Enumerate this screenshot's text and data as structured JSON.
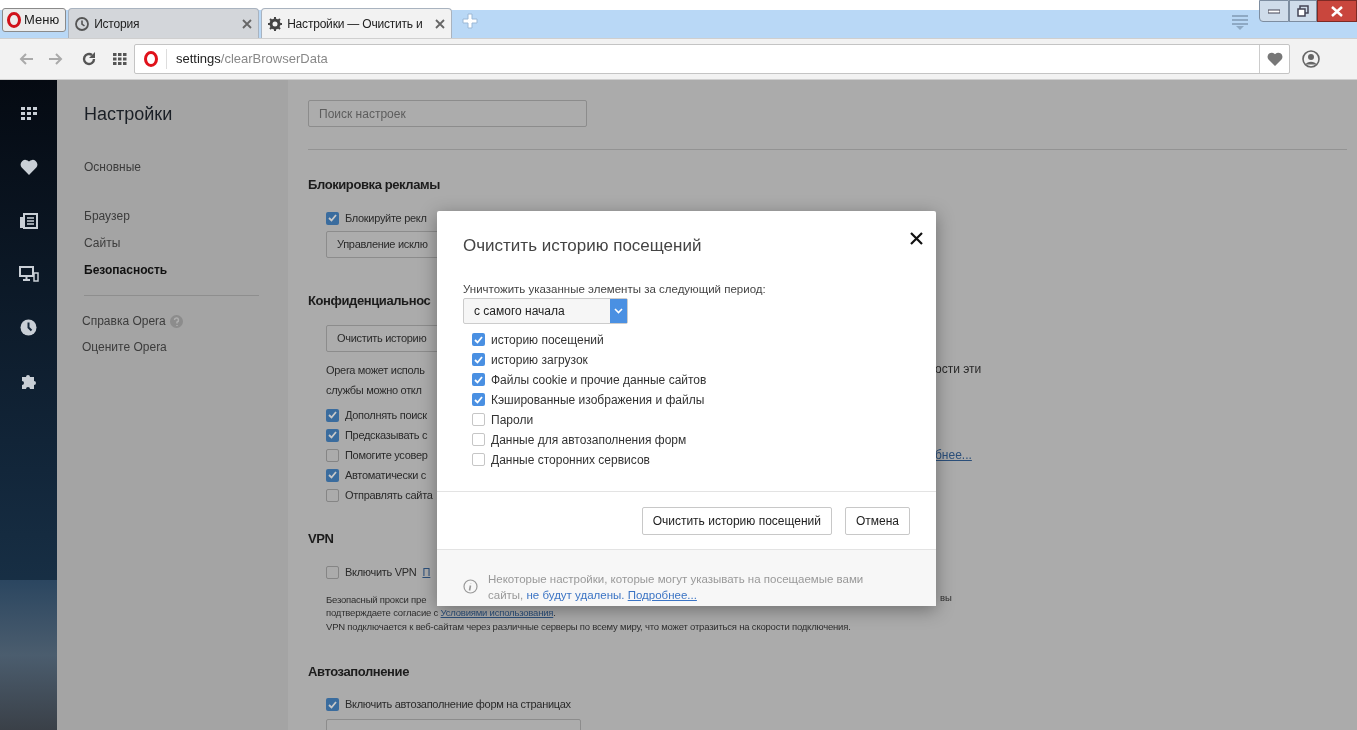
{
  "browser": {
    "menu_label": "Меню",
    "tabs": [
      {
        "title": "История",
        "selected": false
      },
      {
        "title": "Настройки — Очистить и",
        "selected": true
      }
    ],
    "address": {
      "host": "settings",
      "path": "/clearBrowserData"
    }
  },
  "sidebar": {
    "title": "Настройки",
    "groups": [
      [
        {
          "label": "Основные",
          "selected": false
        }
      ],
      [
        {
          "label": "Браузер",
          "selected": false
        },
        {
          "label": "Сайты",
          "selected": false
        },
        {
          "label": "Безопасность",
          "selected": true
        }
      ]
    ],
    "links": [
      {
        "label": "Справка Opera",
        "help": true
      },
      {
        "label": "Оцените Opera",
        "help": false
      }
    ]
  },
  "search": {
    "placeholder": "Поиск настроек"
  },
  "sections": [
    {
      "heading": "Блокировка рекламы",
      "items": [
        {
          "kind": "checkbox",
          "label": "Блокируйте рекл",
          "checked": true
        },
        {
          "kind": "button",
          "label": "Управление исклю"
        }
      ]
    },
    {
      "heading": "Конфиденциальнос",
      "items": [
        {
          "kind": "button",
          "label": "Очистить историю"
        },
        {
          "kind": "paragraph",
          "lines": [
            {
              "left": "Opera может исполь",
              "right": "ости эти"
            },
            {
              "left": "службы можно откл"
            }
          ]
        },
        {
          "kind": "checkbox",
          "label": "Дополнять поиск",
          "checked": true
        },
        {
          "kind": "checkbox",
          "label": "Предсказывать с",
          "checked": true
        },
        {
          "kind": "checkbox",
          "label": "Помогите усовер",
          "checked": false,
          "right_link": "бнее..."
        },
        {
          "kind": "checkbox",
          "label": "Автоматически с",
          "checked": true
        },
        {
          "kind": "checkbox",
          "label": "Отправлять сайта",
          "checked": false
        }
      ]
    },
    {
      "heading": "VPN",
      "items": [
        {
          "kind": "checkbox",
          "label": "Включить VPN",
          "checked": false,
          "link": "П"
        },
        {
          "kind": "note",
          "lines": [
            {
              "text": "Безопасный прокси пре",
              "right": "вы"
            },
            {
              "text": "подтверждаете согласие с",
              "link": "Условиями использования",
              "after": "."
            },
            {
              "text": "VPN подключается к веб-сайтам через различные серверы по всему миру, что может отразиться на скорости подключения."
            }
          ]
        }
      ]
    },
    {
      "heading": "Автозаполнение",
      "items": [
        {
          "kind": "checkbox",
          "label": "Включить автозаполнение форм на страницах",
          "checked": true
        },
        {
          "kind": "blank_button"
        }
      ]
    }
  ],
  "dialog": {
    "title": "Очистить историю посещений",
    "period_label": "Уничтожить указанные элементы за следующий период:",
    "period": "с самого начала",
    "options": [
      {
        "label": "историю посещений",
        "checked": true
      },
      {
        "label": "историю загрузок",
        "checked": true
      },
      {
        "label": "Файлы cookie и прочие данные сайтов",
        "checked": true
      },
      {
        "label": "Кэшированные изображения и файлы",
        "checked": true
      },
      {
        "label": "Пароли",
        "checked": false
      },
      {
        "label": "Данные для автозаполнения форм",
        "checked": false
      },
      {
        "label": "Данные сторонних сервисов",
        "checked": false
      }
    ],
    "buttons": [
      "Очистить историю посещений",
      "Отмена"
    ],
    "footer": {
      "text": "Некоторые настройки, которые могут указывать на посещаемые вами сайты,",
      "emphasis": "не будут удалены.",
      "link": "Подробнее..."
    }
  }
}
